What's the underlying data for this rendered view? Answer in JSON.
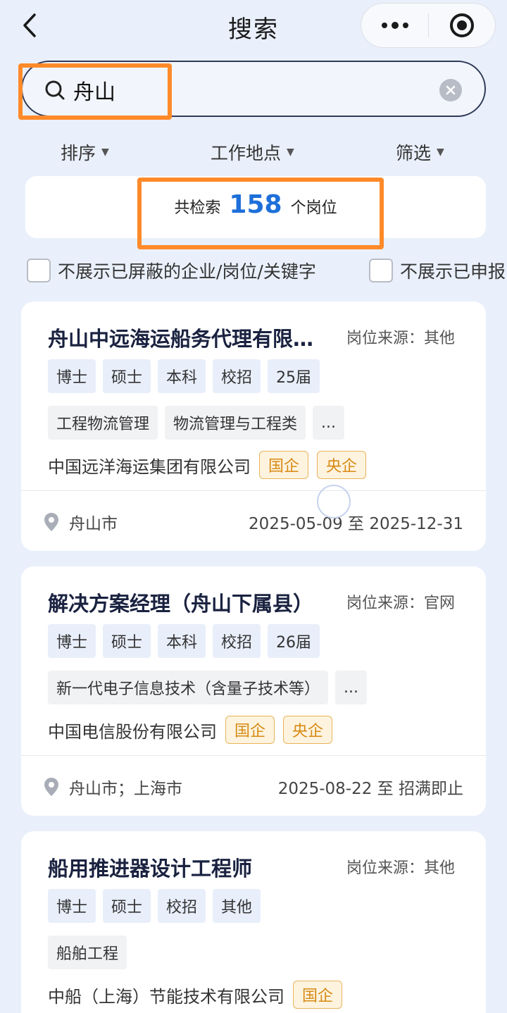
{
  "header": {
    "title": "搜索",
    "more_icon": "more-dots-icon",
    "target_icon": "record-target-icon"
  },
  "search": {
    "value": "舟山"
  },
  "filters": [
    {
      "label": "排序"
    },
    {
      "label": "工作地点"
    },
    {
      "label": "筛选"
    }
  ],
  "count": {
    "prefix": "共检索",
    "number": "158",
    "suffix": "个岗位"
  },
  "checks": [
    {
      "label": "不展示已屏蔽的企业/岗位/关键字"
    },
    {
      "label": "不展示已申报"
    }
  ],
  "jobs": [
    {
      "title": "舟山中远海运船务代理有限…",
      "source": "岗位来源：其他",
      "tags": [
        "博士",
        "硕士",
        "本科",
        "校招",
        "25届"
      ],
      "majors": [
        "工程物流管理",
        "物流管理与工程类",
        "..."
      ],
      "company": "中国远洋海运集团有限公司",
      "badges": [
        "国企",
        "央企"
      ],
      "location": "舟山市",
      "date": "2025-05-09 至 2025-12-31"
    },
    {
      "title": "解决方案经理（舟山下属县）",
      "source": "岗位来源：官网",
      "tags": [
        "博士",
        "硕士",
        "本科",
        "校招",
        "26届"
      ],
      "majors": [
        "新一代电子信息技术（含量子技术等）",
        "..."
      ],
      "company": "中国电信股份有限公司",
      "badges": [
        "国企",
        "央企"
      ],
      "location": "舟山市；上海市",
      "date": "2025-08-22 至 招满即止"
    },
    {
      "title": "船用推进器设计工程师",
      "source": "岗位来源：其他",
      "tags": [
        "博士",
        "硕士",
        "校招",
        "其他"
      ],
      "majors": [
        "船舶工程"
      ],
      "company": "中船（上海）节能技术有限公司",
      "badges": [
        "国企"
      ]
    }
  ],
  "colors": {
    "accent": "#1e6fd9",
    "highlight": "#ff8a2a",
    "badge": "#d78a12",
    "background": "#eaf0fb"
  }
}
